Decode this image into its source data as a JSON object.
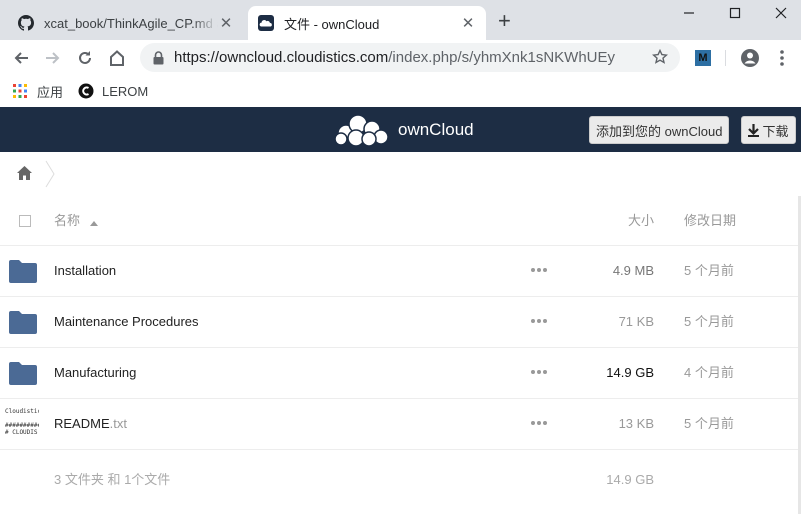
{
  "browser": {
    "tabs": [
      {
        "title": "xcat_book/ThinkAgile_CP.md at master",
        "favicon": "github-icon",
        "active": false
      },
      {
        "title": "文件 - ownCloud",
        "favicon": "owncloud-icon",
        "active": true
      }
    ],
    "url": {
      "host": "https://owncloud.cloudistics.com",
      "path": "/index.php/s/yhmXnk1sNKWhUEy"
    },
    "extension_label": "M",
    "bookmarks": [
      {
        "label": "应用",
        "icon": "apps-grid-icon"
      },
      {
        "label": "LEROM",
        "icon": "lerom-icon"
      }
    ]
  },
  "owncloud": {
    "brand": "ownCloud",
    "add_button": "添加到您的 ownCloud",
    "download_button": "下载",
    "colors": {
      "header_bg": "#1d2d44",
      "folder": "#4b6a95"
    }
  },
  "filelist": {
    "headers": {
      "name": "名称",
      "size": "大小",
      "modified": "修改日期"
    },
    "rows": [
      {
        "name": "Installation",
        "ext": "",
        "type": "folder",
        "size": "4.9 MB",
        "modified": "5 个月前"
      },
      {
        "name": "Maintenance Procedures",
        "ext": "",
        "type": "folder",
        "size": "71 KB",
        "modified": "5 个月前"
      },
      {
        "name": "Manufacturing",
        "ext": "",
        "type": "folder",
        "size": "14.9 GB",
        "modified": "4 个月前"
      },
      {
        "name": "README",
        "ext": ".txt",
        "type": "file",
        "size": "13 KB",
        "modified": "5 个月前"
      }
    ],
    "thumb_text": [
      "Cloudistics",
      "",
      "##########",
      "# CLOUDIS"
    ],
    "summary": {
      "text": "3 文件夹 和 1个文件",
      "size": "14.9 GB"
    }
  }
}
